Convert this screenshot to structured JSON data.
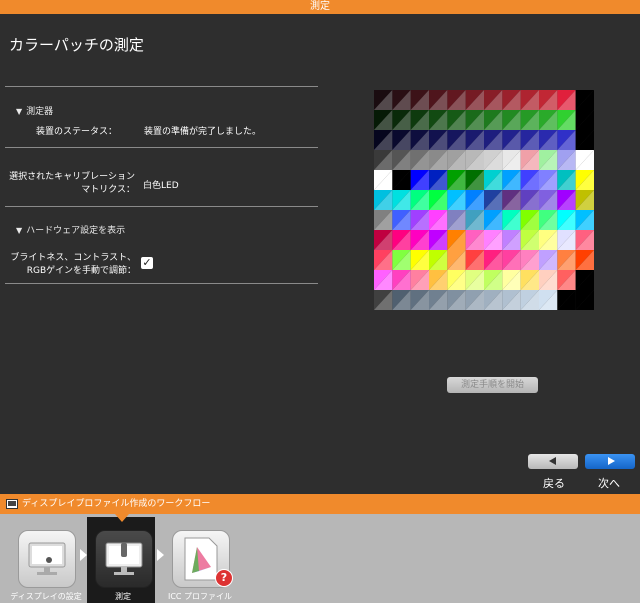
{
  "window": {
    "title": "測定"
  },
  "page": {
    "title": "カラーパッチの測定"
  },
  "instrument": {
    "section_label": "測定器",
    "status_label": "装置のステータス：",
    "status_value": "装置の準備が完了しました。"
  },
  "calibration": {
    "label": "選択されたキャリブレーションマトリクス：",
    "value": "白色LED"
  },
  "hardware": {
    "section_label": "ハードウェア設定を表示"
  },
  "manual_gain": {
    "label": "ブライトネス、コントラスト、RGBゲインを手動で調節：",
    "checked": true
  },
  "patches": {
    "rows": [
      [
        "#1a0c10",
        "#2a0f14",
        "#3c1218",
        "#4f151c",
        "#621820",
        "#751b24",
        "#881e28",
        "#9b212c",
        "#ae2430",
        "#c12734",
        "#e0203c",
        "#000000"
      ],
      [
        "#061a06",
        "#0a2a0a",
        "#0e3a0e",
        "#124a12",
        "#165a16",
        "#1a6a1a",
        "#1e7a1e",
        "#228a22",
        "#269a26",
        "#2aaa2a",
        "#30d030",
        "#000000"
      ],
      [
        "#06061e",
        "#0a0a2e",
        "#0e0e3e",
        "#12124e",
        "#16165e",
        "#1a1a6e",
        "#1e1e7e",
        "#22228e",
        "#26269e",
        "#2a2aae",
        "#3030c8",
        "#000000"
      ],
      [
        "#3a3a3a",
        "#555555",
        "#707070",
        "#8a8a8a",
        "#a0a0a0",
        "#b8b8b8",
        "#d0d0d0",
        "#e8e8e8",
        "#f0a0a8",
        "#a0f0a0",
        "#a0a0f0",
        "#ffffff"
      ],
      [
        "#ffffff",
        "#000000",
        "#0000ff",
        "#0020c0",
        "#00a000",
        "#007000",
        "#00d0d0",
        "#00a0ff",
        "#4040ff",
        "#8080ff",
        "#00c0c0",
        "#ffff00"
      ],
      [
        "#00c0e0",
        "#00e0e0",
        "#00ff80",
        "#00ff40",
        "#00c0ff",
        "#0080ff",
        "#2040a0",
        "#603080",
        "#6040c0",
        "#8060e0",
        "#a000ff",
        "#c0c000"
      ],
      [
        "#808080",
        "#4060ff",
        "#a040ff",
        "#ff40ff",
        "#8080c0",
        "#40a0c0",
        "#00a0ff",
        "#00ffc0",
        "#80ff00",
        "#40ff80",
        "#00ffff",
        "#00c0ff"
      ],
      [
        "#c00040",
        "#ff0080",
        "#ff00c0",
        "#c000ff",
        "#ff8000",
        "#ff60c0",
        "#ff80ff",
        "#c080ff",
        "#c0ff40",
        "#ffff80",
        "#e0e0ff",
        "#ff6080"
      ],
      [
        "#ff4060",
        "#80ff40",
        "#ffff00",
        "#c0ff00",
        "#ffa040",
        "#ff4040",
        "#ff2080",
        "#ff40a0",
        "#ff80c0",
        "#c0a0ff",
        "#ff8040",
        "#ff4000"
      ],
      [
        "#ff60ff",
        "#ff40c0",
        "#ff80a0",
        "#ffc040",
        "#ffff60",
        "#e0ff80",
        "#c0ff60",
        "#ffffa0",
        "#ffe060",
        "#ffd0c0",
        "#ff6060",
        "#000000"
      ],
      [
        "#404040",
        "#506070",
        "#607080",
        "#708090",
        "#8090a0",
        "#90a0b0",
        "#a0b0c0",
        "#b0c0d0",
        "#c0d0e0",
        "#d0e0f0",
        "#000000",
        "#000000"
      ]
    ]
  },
  "buttons": {
    "start_measure": "測定手順を開始",
    "back": "戻る",
    "next": "次へ"
  },
  "workflow": {
    "title": "ディスプレイプロファイル作成のワークフロー",
    "steps": [
      {
        "label": "ディスプレイの設定",
        "icon": "monitor-settings-icon"
      },
      {
        "label": "測定",
        "icon": "monitor-measure-icon",
        "active": true
      },
      {
        "label": "ICC プロファイル",
        "icon": "icc-profile-icon"
      }
    ]
  },
  "colors": {
    "accent": "#f08a2c",
    "background": "#2e2e2e",
    "next_button": "#1a7be0"
  }
}
